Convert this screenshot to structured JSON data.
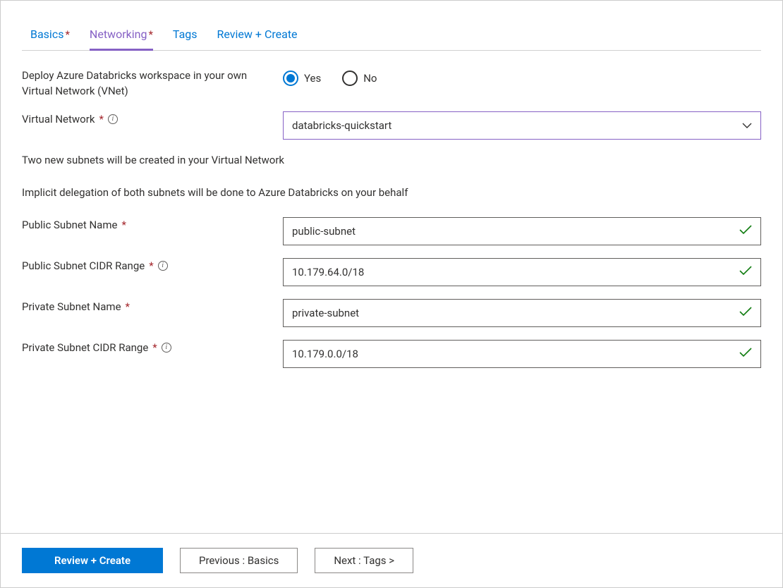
{
  "tabs": [
    {
      "label": "Basics",
      "required": true,
      "active": false
    },
    {
      "label": "Networking",
      "required": true,
      "active": true
    },
    {
      "label": "Tags",
      "required": false,
      "active": false
    },
    {
      "label": "Review + Create",
      "required": false,
      "active": false
    }
  ],
  "vnet_deploy": {
    "label": "Deploy Azure Databricks workspace in your own Virtual Network (VNet)",
    "yes_label": "Yes",
    "no_label": "No",
    "selected": "Yes"
  },
  "virtual_network": {
    "label": "Virtual Network",
    "value": "databricks-quickstart"
  },
  "subnet_note_1": "Two new subnets will be created in your Virtual Network",
  "subnet_note_2": "Implicit delegation of both subnets will be done to Azure Databricks on your behalf",
  "public_subnet_name": {
    "label": "Public Subnet Name",
    "value": "public-subnet"
  },
  "public_subnet_cidr": {
    "label": "Public Subnet CIDR Range",
    "value": "10.179.64.0/18"
  },
  "private_subnet_name": {
    "label": "Private Subnet Name",
    "value": "private-subnet"
  },
  "private_subnet_cidr": {
    "label": "Private Subnet CIDR Range",
    "value": "10.179.0.0/18"
  },
  "footer": {
    "review_create": "Review + Create",
    "previous": "Previous : Basics",
    "next": "Next : Tags >"
  }
}
